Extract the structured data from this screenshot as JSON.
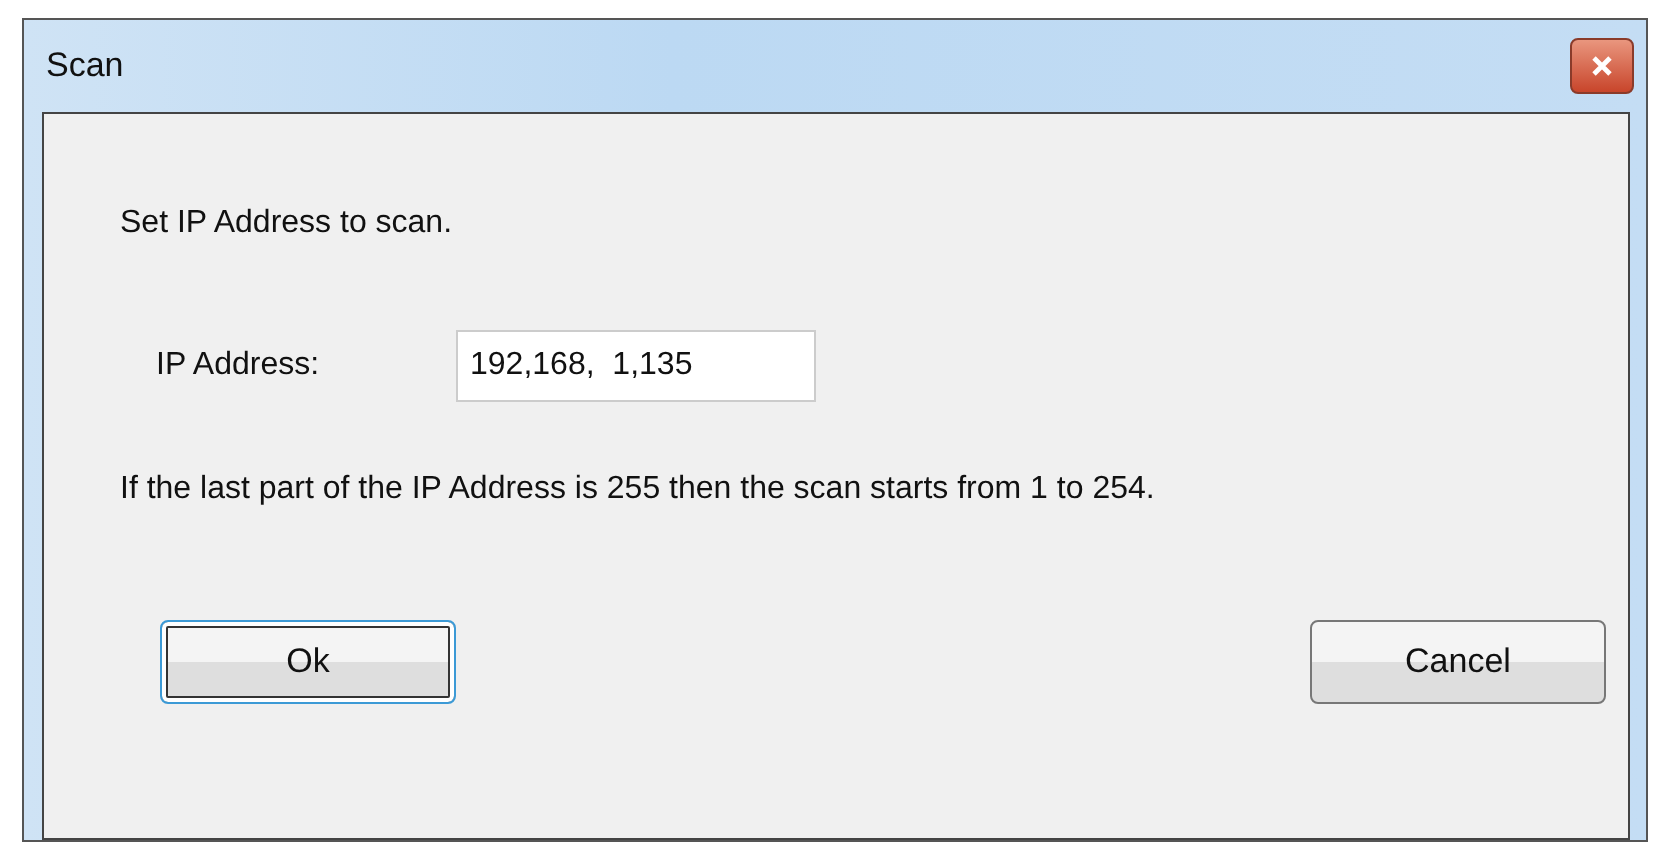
{
  "window": {
    "title": "Scan"
  },
  "instruction": "Set IP Address to scan.",
  "ip_field": {
    "label": "IP Address:",
    "value": "192,168,  1,135"
  },
  "note": "If the last part of the IP Address is 255 then the scan starts from 1 to 254.",
  "buttons": [
    {
      "label": "Ok",
      "focused": true
    },
    {
      "label": "Cancel",
      "focused": false
    }
  ]
}
